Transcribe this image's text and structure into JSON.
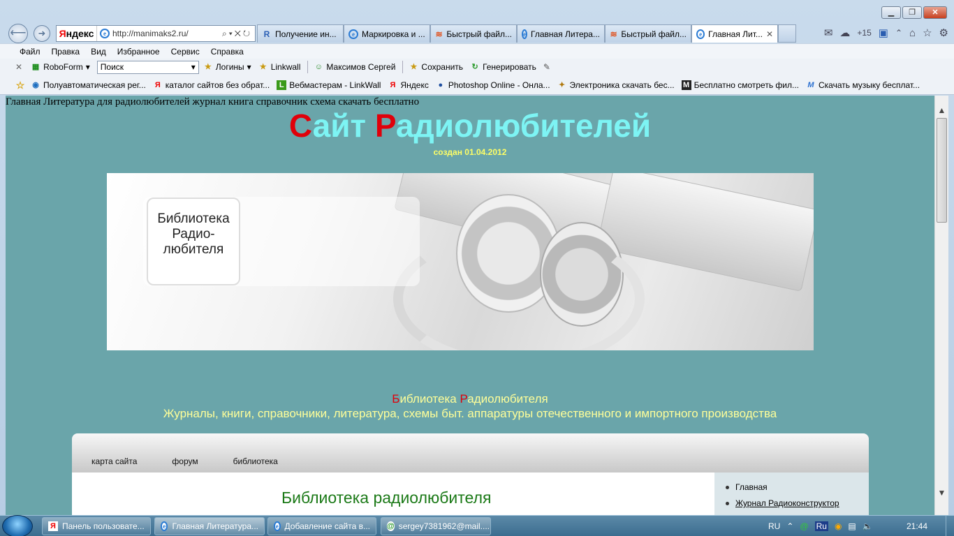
{
  "browser": {
    "url": "http://manimaks2.ru/",
    "tabs": [
      "Получение ин...",
      "Маркировка и ...",
      "Быстрый файл...",
      "Главная Литера...",
      "Быстрый файл...",
      "Главная Лит..."
    ],
    "weather": "+15",
    "menu": [
      "Файл",
      "Правка",
      "Вид",
      "Избранное",
      "Сервис",
      "Справка"
    ],
    "toolbar": {
      "roboform": "RoboForm",
      "search_value": "Поиск",
      "logins": "Логины",
      "linkwall": "Linkwall",
      "user": "Максимов Сергей",
      "save": "Сохранить",
      "generate": "Генерировать"
    },
    "favorites": [
      "Полуавтоматическая рег...",
      "каталог сайтов без обрат...",
      "Вебмастерам - LinkWall",
      "Яндекс",
      "Photoshop Online - Онла...",
      "Электроника скачать бес...",
      "Бесплатно смотреть фил...",
      "Скачать музыку бесплат..."
    ]
  },
  "page": {
    "doc_title": "Главная Литература для радиолюбителей журнал книга справочник схема скачать бесплатно",
    "site_title_1": "С",
    "site_title_2": "айт ",
    "site_title_3": "Р",
    "site_title_4": "адиолюбителей",
    "created": "создан 01.04.2012",
    "banner_text_1": "Библиотека",
    "banner_text_2": "Радио-",
    "banner_text_3": "любителя",
    "lib_1": "Б",
    "lib_2": "иблиотека ",
    "lib_3": "Р",
    "lib_4": "адиолюбителя",
    "lib_sub": "Журналы, книги, справочники, литература, схемы быт. аппаратуры отечественного и импортного производства",
    "nav": [
      "карта сайта",
      "форум",
      "библиотека"
    ],
    "heading": "Библиотека радиолюбителя",
    "side": [
      "Главная",
      "Журнал Радиоконструктор"
    ]
  },
  "taskbar": {
    "items": [
      "Панель пользовате...",
      "Главная Литература...",
      "Добавление сайта в...",
      "sergey7381962@mail...."
    ],
    "lang": "RU",
    "time": "21:44"
  },
  "colors": {
    "page_bg": "#6aa5aa",
    "title_cyan": "#7df4f4",
    "accent_red": "#e0000a",
    "yellow": "#ffff99"
  }
}
